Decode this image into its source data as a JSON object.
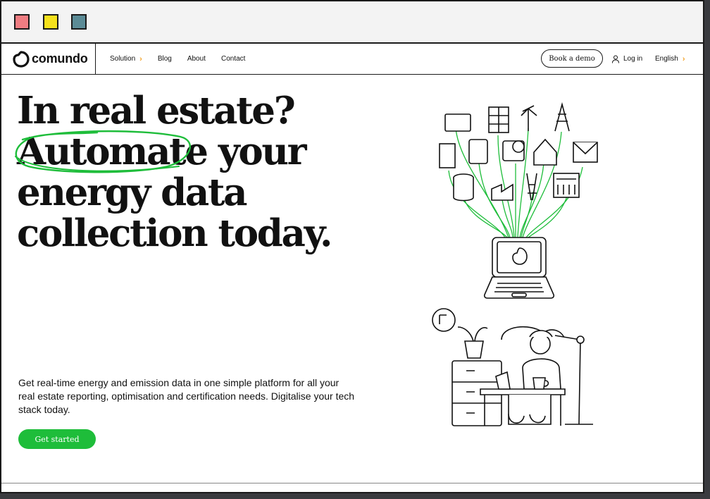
{
  "window": {
    "buttons": [
      {
        "name": "close",
        "color": "#f07d82"
      },
      {
        "name": "minimize",
        "color": "#f6e11c"
      },
      {
        "name": "maximize",
        "color": "#5b8b96"
      }
    ]
  },
  "nav": {
    "logo": "comundo",
    "links": [
      {
        "label": "Solution",
        "has_chevron": true
      },
      {
        "label": "Blog"
      },
      {
        "label": "About"
      },
      {
        "label": "Contact"
      }
    ],
    "book_demo": "Book a demo",
    "login": "Log in",
    "language": "English"
  },
  "hero": {
    "line1": "In real estate?",
    "line2_highlight": "Automate",
    "line2_rest": " your",
    "line3": "energy data",
    "line4": "collection today.",
    "description": "Get real-time energy and emission data in one simple platform for all your real estate reporting, optimisation and certification needs. Digitalise your tech stack today.",
    "cta": "Get started"
  },
  "colors": {
    "accent_green": "#1ebd3a",
    "chevron_orange": "#f3a32a"
  }
}
